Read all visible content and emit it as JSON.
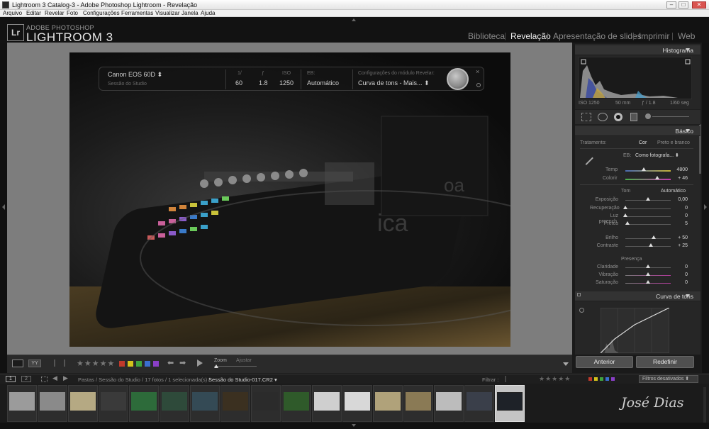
{
  "window": {
    "title": "Lightroom 3 Catalog-3 - Adobe Photoshop Lightroom - Revelação",
    "controls": [
      "–",
      "□",
      "✕"
    ]
  },
  "menu": [
    "Arquivo",
    "Editar",
    "Revelar",
    "Foto",
    "Configurações",
    "Ferramentas",
    "Visualizar",
    "Janela",
    "Ajuda"
  ],
  "identity": {
    "badge": "Lr",
    "adobe": "ADOBE PHOTOSHOP",
    "product": "LIGHTROOM 3"
  },
  "modules": [
    {
      "label": "Biblioteca",
      "active": false
    },
    {
      "label": "Revelação",
      "active": true
    },
    {
      "label": "Apresentação de slides",
      "active": false
    },
    {
      "label": "Imprimir",
      "active": false
    },
    {
      "label": "Web",
      "active": false
    }
  ],
  "info": {
    "camera": "Canon EOS 60D ⬍",
    "session": "Sessão do Studio",
    "h_shutter": "1/",
    "h_aperture": "ƒ",
    "h_iso": "ISO",
    "shutter": "60",
    "aperture": "1.8",
    "iso": "1250",
    "wb_label": "EB:",
    "wb_value": "Automático",
    "preset_label": "Configurações do módulo Revelar:",
    "preset_value": "Curva de tons - Mais... ⬍",
    "close": "×"
  },
  "photo_overlay": {
    "text1": "oa",
    "text2": "ica"
  },
  "histogram": {
    "title": "Histograma",
    "iso": "ISO 1250",
    "focal": "50 mm",
    "aperture": "ƒ / 1.8",
    "shutter": "1/60 seg"
  },
  "basic": {
    "title": "Básico",
    "treatment": "Tratamento:",
    "color": "Cor",
    "bw": "Preto e branco",
    "wb_label": "EB:",
    "wb_value": "Como fotografa... ⬍",
    "temp_label": "Temp",
    "temp_value": "4800",
    "temp_pos": 0.4,
    "tint_label": "Colorir",
    "tint_value": "+ 46",
    "tint_pos": 0.7,
    "tone_label": "Tom",
    "tone_auto": "Automático",
    "sliders": [
      {
        "label": "Exposição",
        "value": "0,00",
        "pos": 0.5
      },
      {
        "label": "Recuperação",
        "value": "0",
        "pos": 0.0
      },
      {
        "label": "Luz preench.",
        "value": "0",
        "pos": 0.0
      },
      {
        "label": "Pretos",
        "value": "5",
        "pos": 0.05
      },
      {
        "label": "Brilho",
        "value": "+ 50",
        "pos": 0.62
      },
      {
        "label": "Contraste",
        "value": "+ 25",
        "pos": 0.56
      }
    ],
    "presence_label": "Presença",
    "presence": [
      {
        "label": "Claridade",
        "value": "0",
        "pos": 0.5
      },
      {
        "label": "Vibração",
        "value": "0",
        "pos": 0.5
      },
      {
        "label": "Saturação",
        "value": "0",
        "pos": 0.5
      }
    ]
  },
  "tone_curve": {
    "title": "Curva de tons"
  },
  "buttons": {
    "previous": "Anterior",
    "reset": "Redefinir"
  },
  "toolbar": {
    "zoom": "Zoom",
    "fit": "Ajustar",
    "stars": "★★★★★",
    "flag_colors": [
      "#c0392b",
      "#d4c21b",
      "#3fa33f",
      "#3a6fd0",
      "#8a3fc7"
    ]
  },
  "filmstrip": {
    "pages": [
      "1",
      "2"
    ],
    "path": "Pastas / Sessão do Studio / 17 fotos / 1 selecionada(s) /",
    "file": "Sessão do Studio-017.CR2 ▾",
    "filter_label": "Filtrar :",
    "filters_off": "Filtros desativados ⬍",
    "thumb_colors": [
      "#9b9b9b",
      "#8a8a8a",
      "#b5a983",
      "#3a3a3a",
      "#2d6b3a",
      "#2e4a3a",
      "#344a55",
      "#3b3020",
      "#2b2b2b",
      "#2f5a2a",
      "#cfcfcf",
      "#d8d8d8",
      "#b0a27a",
      "#8a7a55",
      "#bcbcbc",
      "#3a3f4a",
      "#1e2228"
    ],
    "signature": "José Dias"
  }
}
